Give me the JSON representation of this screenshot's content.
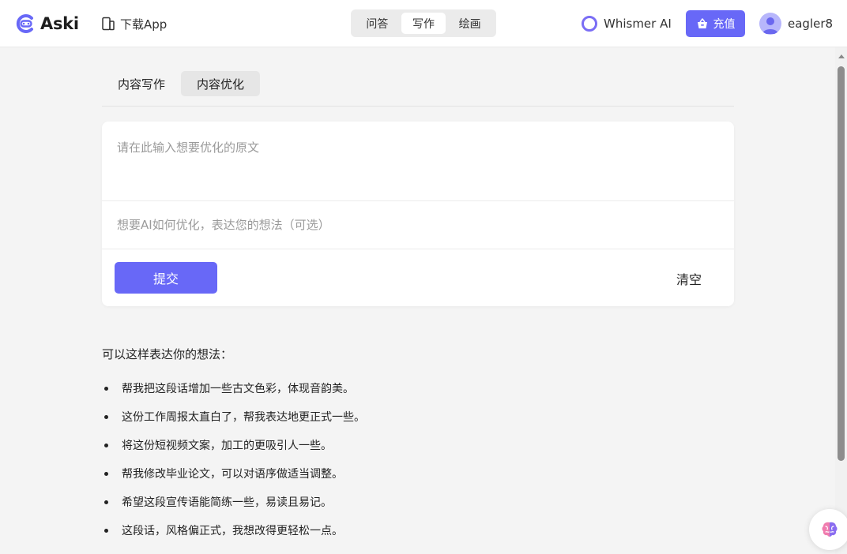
{
  "header": {
    "logo_text": "Aski",
    "download_label": "下载App",
    "mode_tabs": [
      {
        "label": "问答",
        "active": false
      },
      {
        "label": "写作",
        "active": true
      },
      {
        "label": "绘画",
        "active": false
      }
    ],
    "model_label": "Whismer AI",
    "recharge_label": "充值",
    "username": "eagler8"
  },
  "sub_tabs": [
    {
      "label": "内容写作",
      "active": false
    },
    {
      "label": "内容优化",
      "active": true
    }
  ],
  "form": {
    "original_placeholder": "请在此输入想要优化的原文",
    "idea_placeholder": "想要AI如何优化，表达您的想法（可选）",
    "submit_label": "提交",
    "clear_label": "清空"
  },
  "tips": {
    "title": "可以这样表达你的想法：",
    "items": [
      "帮我把这段话增加一些古文色彩，体现音韵美。",
      "这份工作周报太直白了，帮我表达地更正式一些。",
      "将这份短视频文案，加工的更吸引人一些。",
      "帮我修改毕业论文，可以对语序做适当调整。",
      "希望这段宣传语能简练一些，易读且易记。",
      "这段话，风格偏正式，我想改得更轻松一点。"
    ]
  },
  "colors": {
    "accent": "#6868f7",
    "background": "#f4f4f4"
  }
}
